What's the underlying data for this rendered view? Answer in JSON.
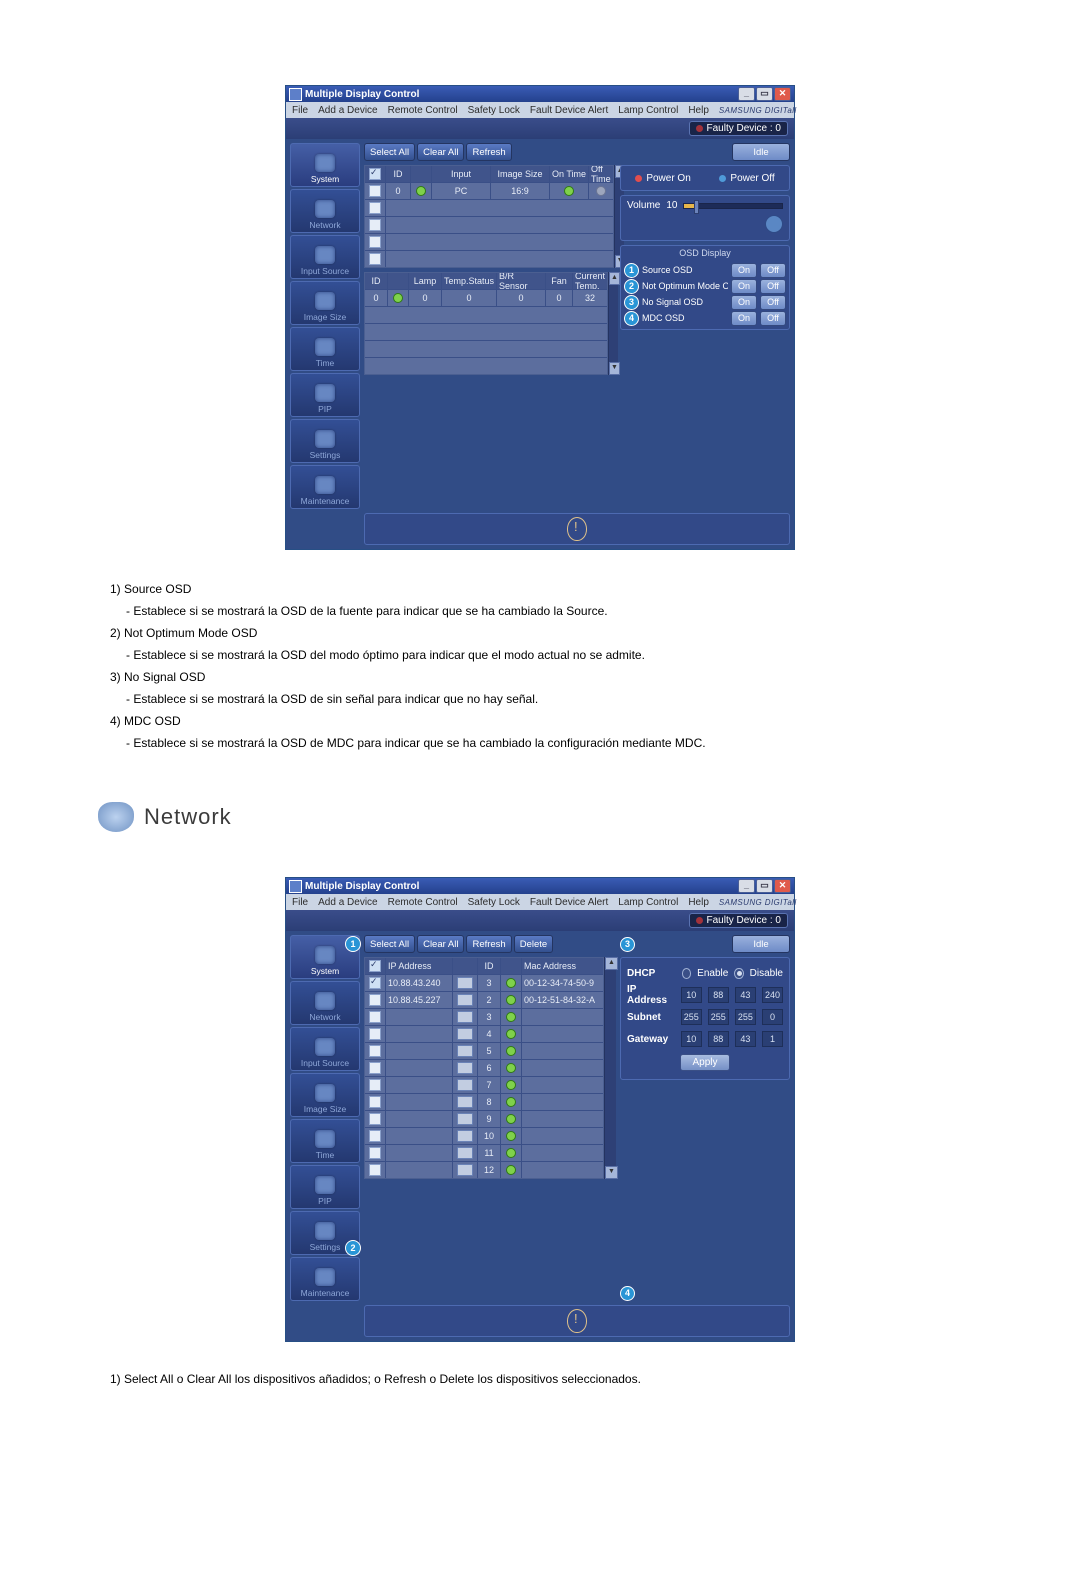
{
  "window": {
    "title": "Multiple Display Control",
    "menus": [
      "File",
      "Add a Device",
      "Remote Control",
      "Safety Lock",
      "Fault Device Alert",
      "Lamp Control",
      "Help"
    ],
    "brand": "SAMSUNG DIGITall",
    "faulty_label": "Faulty Device : 0",
    "win_buttons": {
      "min": "_",
      "max": "▭",
      "close": "✕"
    }
  },
  "toolbar": {
    "select_all": "Select All",
    "clear_all": "Clear All",
    "refresh": "Refresh",
    "delete": "Delete",
    "idle": "Idle"
  },
  "sidebar": {
    "items": [
      {
        "label": "System"
      },
      {
        "label": "Network"
      },
      {
        "label": "Input Source"
      },
      {
        "label": "Image Size"
      },
      {
        "label": "Time"
      },
      {
        "label": "PIP"
      },
      {
        "label": "Settings"
      },
      {
        "label": "Maintenance"
      }
    ]
  },
  "grid1a": {
    "headers": [
      "",
      "ID",
      "",
      "Input",
      "Image Size",
      "On Time",
      "Off Time"
    ],
    "row1": {
      "id": "0",
      "input": "PC",
      "size": "16:9"
    }
  },
  "grid1b": {
    "headers": [
      "ID",
      "",
      "Lamp",
      "Temp.Status",
      "B/R Sensor",
      "Fan",
      "Current Temp."
    ],
    "row1": {
      "id": "0",
      "lamp": "0",
      "temp": "0",
      "br": "0",
      "fan": "0",
      "ct": "32"
    }
  },
  "power": {
    "on": "Power On",
    "off": "Power Off"
  },
  "volume": {
    "label": "Volume",
    "value": "10"
  },
  "osd": {
    "header": "OSD Display",
    "rows": [
      {
        "n": "1",
        "label": "Source OSD"
      },
      {
        "n": "2",
        "label": "Not Optimum Mode OSD"
      },
      {
        "n": "3",
        "label": "No Signal OSD"
      },
      {
        "n": "4",
        "label": "MDC OSD"
      }
    ],
    "on": "On",
    "off": "Off"
  },
  "notes1": [
    {
      "n": "1)",
      "t": "Source OSD",
      "d": "- Establece si se mostrará la OSD de la fuente para indicar que se ha cambiado la Source."
    },
    {
      "n": "2)",
      "t": "Not Optimum Mode OSD",
      "d": "- Establece si se mostrará la OSD del modo óptimo para indicar que el modo actual no se admite."
    },
    {
      "n": "3)",
      "t": "No Signal OSD",
      "d": "- Establece si se mostrará la OSD de sin señal para indicar que no hay señal."
    },
    {
      "n": "4)",
      "t": "MDC OSD",
      "d": "- Establece si se mostrará la OSD de MDC para indicar que se ha cambiado la configuración mediante MDC."
    }
  ],
  "section_network": "Network",
  "net_table": {
    "headers": [
      "",
      "IP Address",
      "",
      "ID",
      "",
      "Mac Address"
    ],
    "rows": [
      {
        "ip": "10.88.43.240",
        "id": "3",
        "mac": "00-12-34-74-50-9"
      },
      {
        "ip": "10.88.45.227",
        "id": "2",
        "mac": "00-12-51-84-32-A"
      },
      {
        "ip": "",
        "id": "3",
        "mac": ""
      },
      {
        "ip": "",
        "id": "4",
        "mac": ""
      },
      {
        "ip": "",
        "id": "5",
        "mac": ""
      },
      {
        "ip": "",
        "id": "6",
        "mac": ""
      },
      {
        "ip": "",
        "id": "7",
        "mac": ""
      },
      {
        "ip": "",
        "id": "8",
        "mac": ""
      },
      {
        "ip": "",
        "id": "9",
        "mac": ""
      },
      {
        "ip": "",
        "id": "10",
        "mac": ""
      },
      {
        "ip": "",
        "id": "11",
        "mac": ""
      },
      {
        "ip": "",
        "id": "12",
        "mac": ""
      }
    ]
  },
  "net_panel": {
    "dhcp": "DHCP",
    "enable": "Enable",
    "disable": "Disable",
    "ip_label": "IP Address",
    "ip": [
      "10",
      "88",
      "43",
      "240"
    ],
    "subnet_label": "Subnet",
    "subnet": [
      "255",
      "255",
      "255",
      "0"
    ],
    "gateway_label": "Gateway",
    "gateway": [
      "10",
      "88",
      "43",
      "1"
    ],
    "apply": "Apply"
  },
  "markers": {
    "m1": "1",
    "m2": "2",
    "m3": "3",
    "m4": "4"
  },
  "notes2": "1) Select All o Clear All los dispositivos añadidos; o Refresh o Delete los dispositivos seleccionados."
}
